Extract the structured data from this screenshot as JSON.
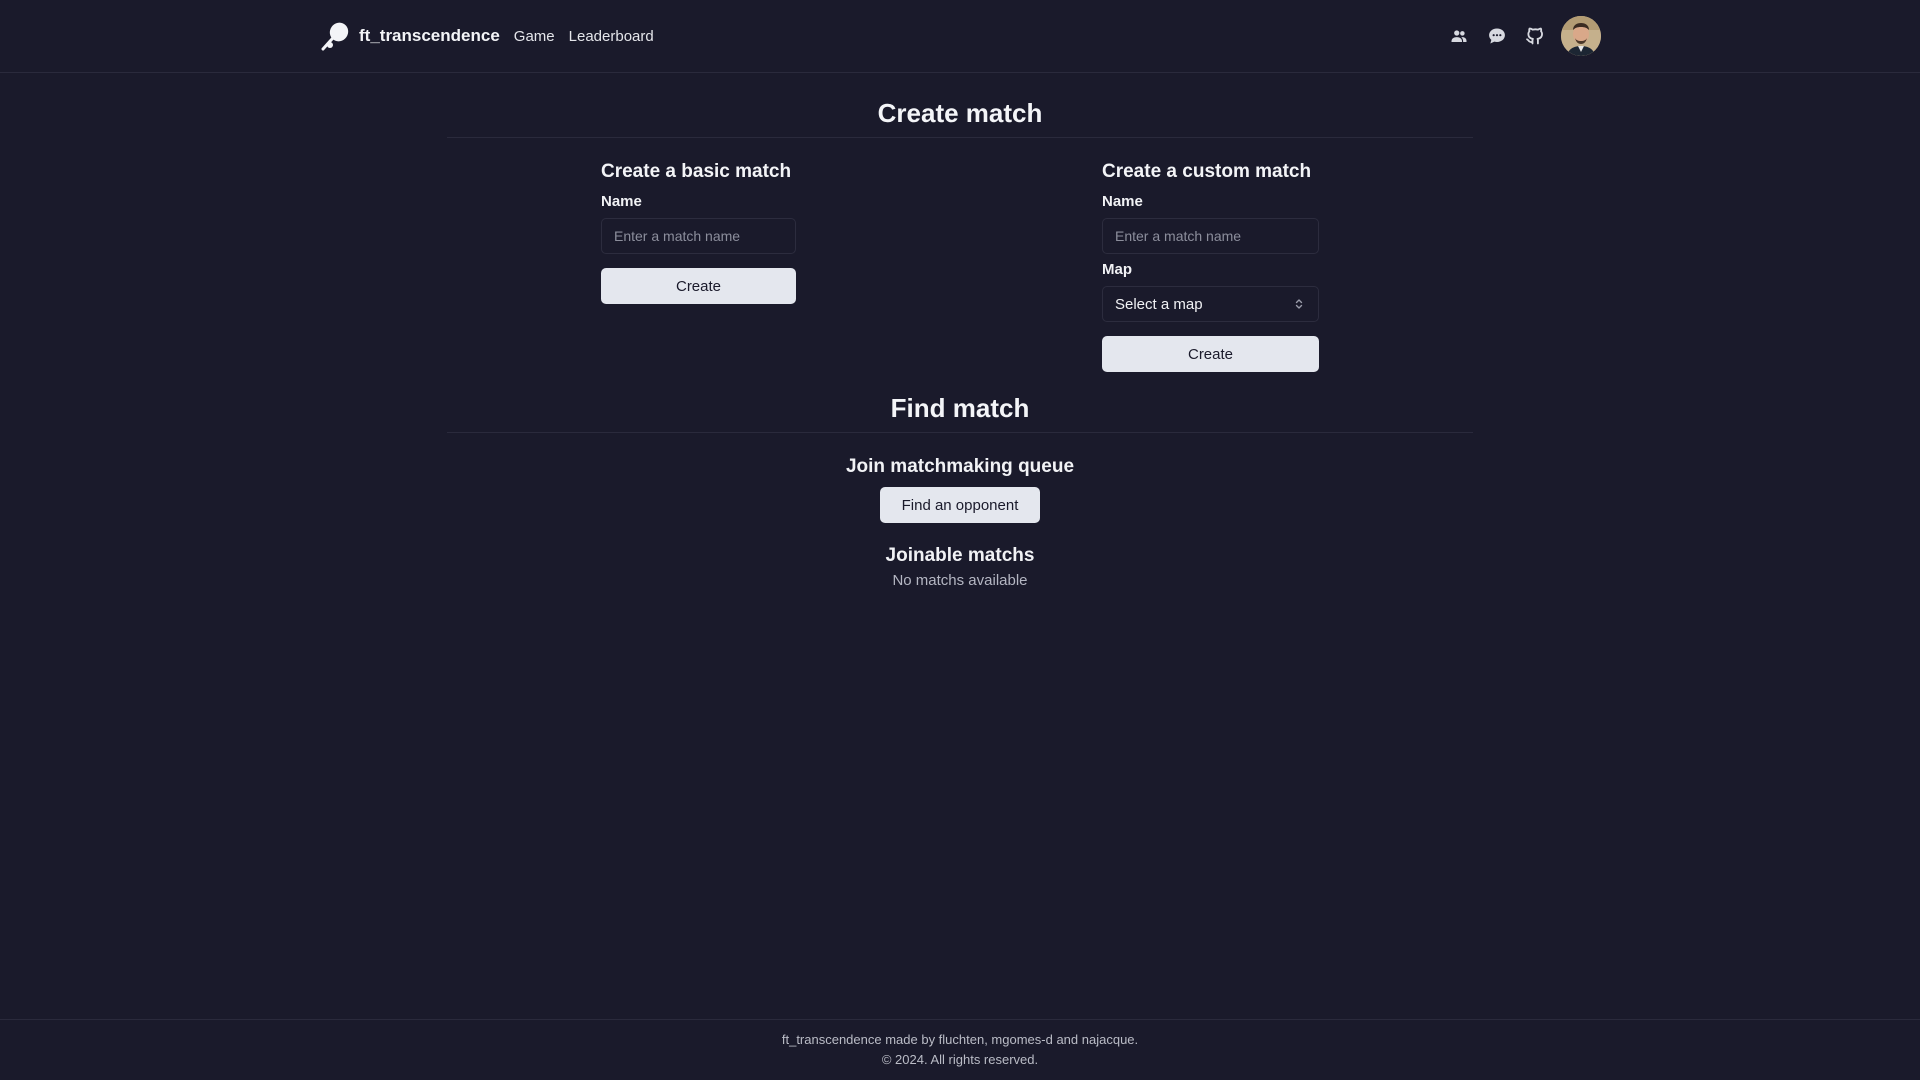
{
  "header": {
    "brand": "ft_transcendence",
    "nav": [
      "Game",
      "Leaderboard"
    ],
    "icons": [
      "friends-icon",
      "chat-icon",
      "github-icon"
    ]
  },
  "create": {
    "title": "Create match",
    "basic": {
      "title": "Create a basic match",
      "name_label": "Name",
      "name_placeholder": "Enter a match name",
      "create_label": "Create"
    },
    "custom": {
      "title": "Create a custom match",
      "name_label": "Name",
      "name_placeholder": "Enter a match name",
      "map_label": "Map",
      "map_selected": "Select a map",
      "create_label": "Create"
    }
  },
  "find": {
    "title": "Find match",
    "queue_title": "Join matchmaking queue",
    "queue_button": "Find an opponent",
    "joinable_title": "Joinable matchs",
    "joinable_empty": "No matchs available"
  },
  "footer": {
    "credits": "ft_transcendence made by fluchten, mgomes-d and najacque.",
    "copyright": "© 2024. All rights reserved."
  }
}
